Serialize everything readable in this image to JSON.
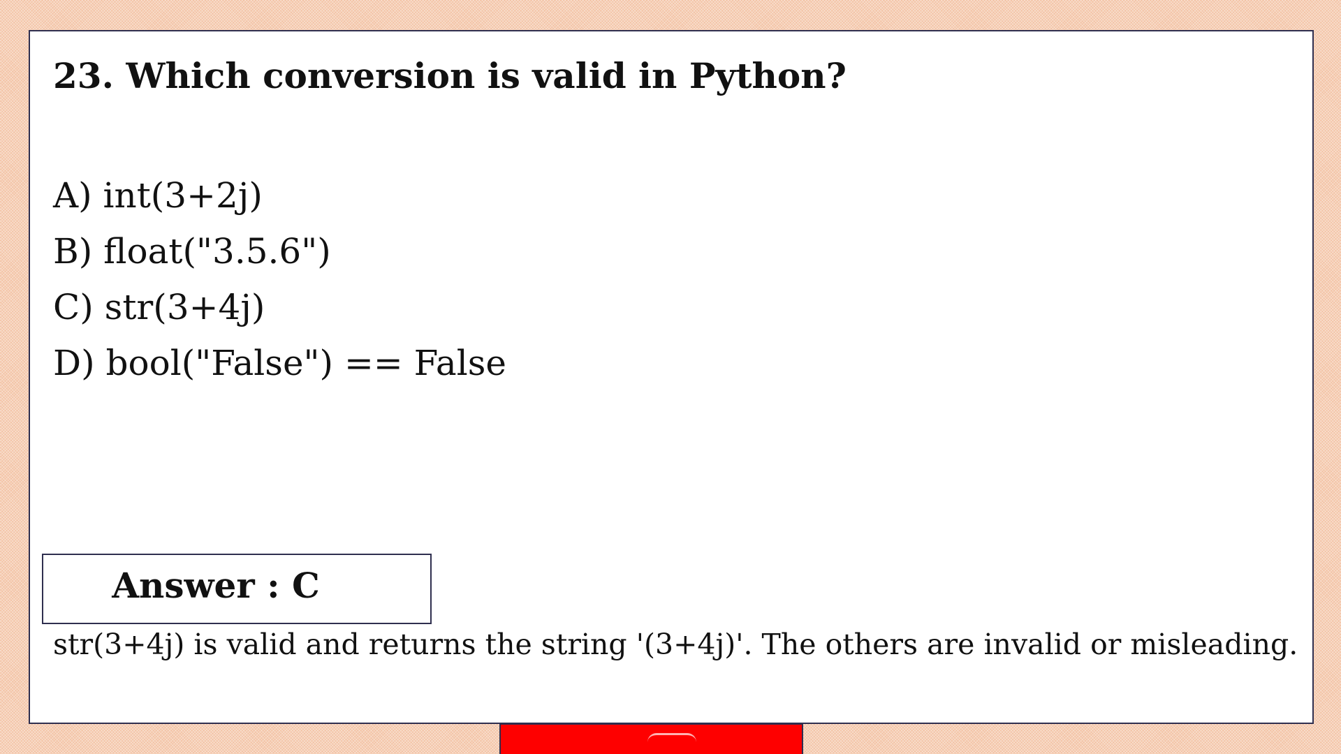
{
  "question": "23. Which conversion is valid in Python?",
  "options": [
    "A) int(3+2j)",
    "B) float(\"3.5.6\")",
    "C) str(3+4j)",
    "D) bool(\"False\") == False"
  ],
  "answer_label": "Answer : C",
  "explanation": "str(3+4j) is valid and returns the string '(3+4j)'. The others are invalid or misleading.",
  "colors": {
    "background": "#f3c3a5",
    "card": "#ffffff",
    "border": "#2f2f4f",
    "banner": "#fe0000"
  }
}
